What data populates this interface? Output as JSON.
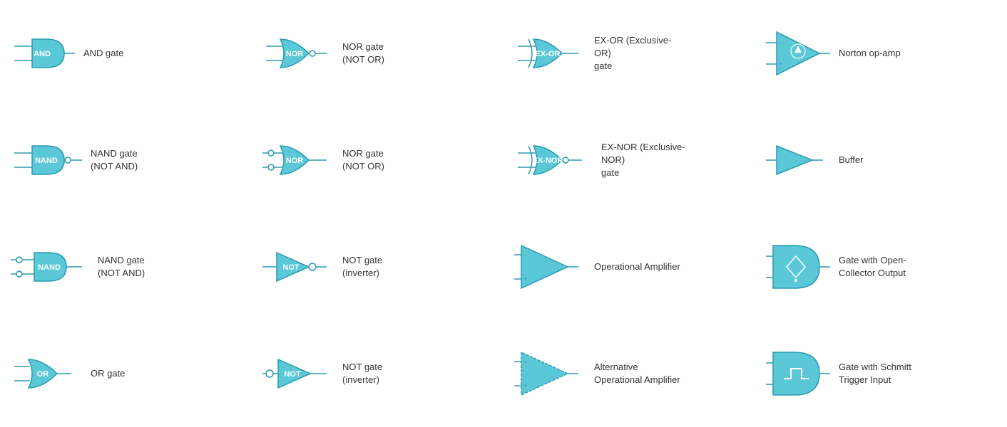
{
  "cells": [
    {
      "id": "and-gate",
      "label": "AND gate",
      "row": 1,
      "col": 1
    },
    {
      "id": "nor-gate-1",
      "label": "NOR gate\n(NOT OR)",
      "row": 1,
      "col": 2
    },
    {
      "id": "ex-or-gate",
      "label": "EX-OR (Exclusive-OR)\ngate",
      "row": 1,
      "col": 3
    },
    {
      "id": "norton-opamp",
      "label": "Norton op-amp",
      "row": 1,
      "col": 4
    },
    {
      "id": "nand-gate-1",
      "label": "NAND gate\n(NOT AND)",
      "row": 2,
      "col": 1
    },
    {
      "id": "nor-gate-2",
      "label": "NOR gate\n(NOT OR)",
      "row": 2,
      "col": 2
    },
    {
      "id": "ex-nor-gate",
      "label": "EX-NOR (Exclusive-NOR)\ngate",
      "row": 2,
      "col": 3
    },
    {
      "id": "buffer",
      "label": "Buffer",
      "row": 2,
      "col": 4
    },
    {
      "id": "nand-gate-2",
      "label": "NAND gate\n(NOT AND)",
      "row": 3,
      "col": 1
    },
    {
      "id": "not-gate-1",
      "label": "NOT gate\n(inverter)",
      "row": 3,
      "col": 2
    },
    {
      "id": "op-amp",
      "label": "Operational Amplifier",
      "row": 3,
      "col": 3
    },
    {
      "id": "open-collector",
      "label": "Gate with Open-Collector Output",
      "row": 3,
      "col": 4
    },
    {
      "id": "or-gate",
      "label": "OR gate",
      "row": 4,
      "col": 1
    },
    {
      "id": "not-gate-2",
      "label": "NOT gate\n(inverter)",
      "row": 4,
      "col": 2
    },
    {
      "id": "alt-op-amp",
      "label": "Alternative\nOperational Amplifier",
      "row": 4,
      "col": 3
    },
    {
      "id": "schmitt-trigger",
      "label": "Gate with Schmitt\nTrigger Input",
      "row": 4,
      "col": 4
    }
  ]
}
